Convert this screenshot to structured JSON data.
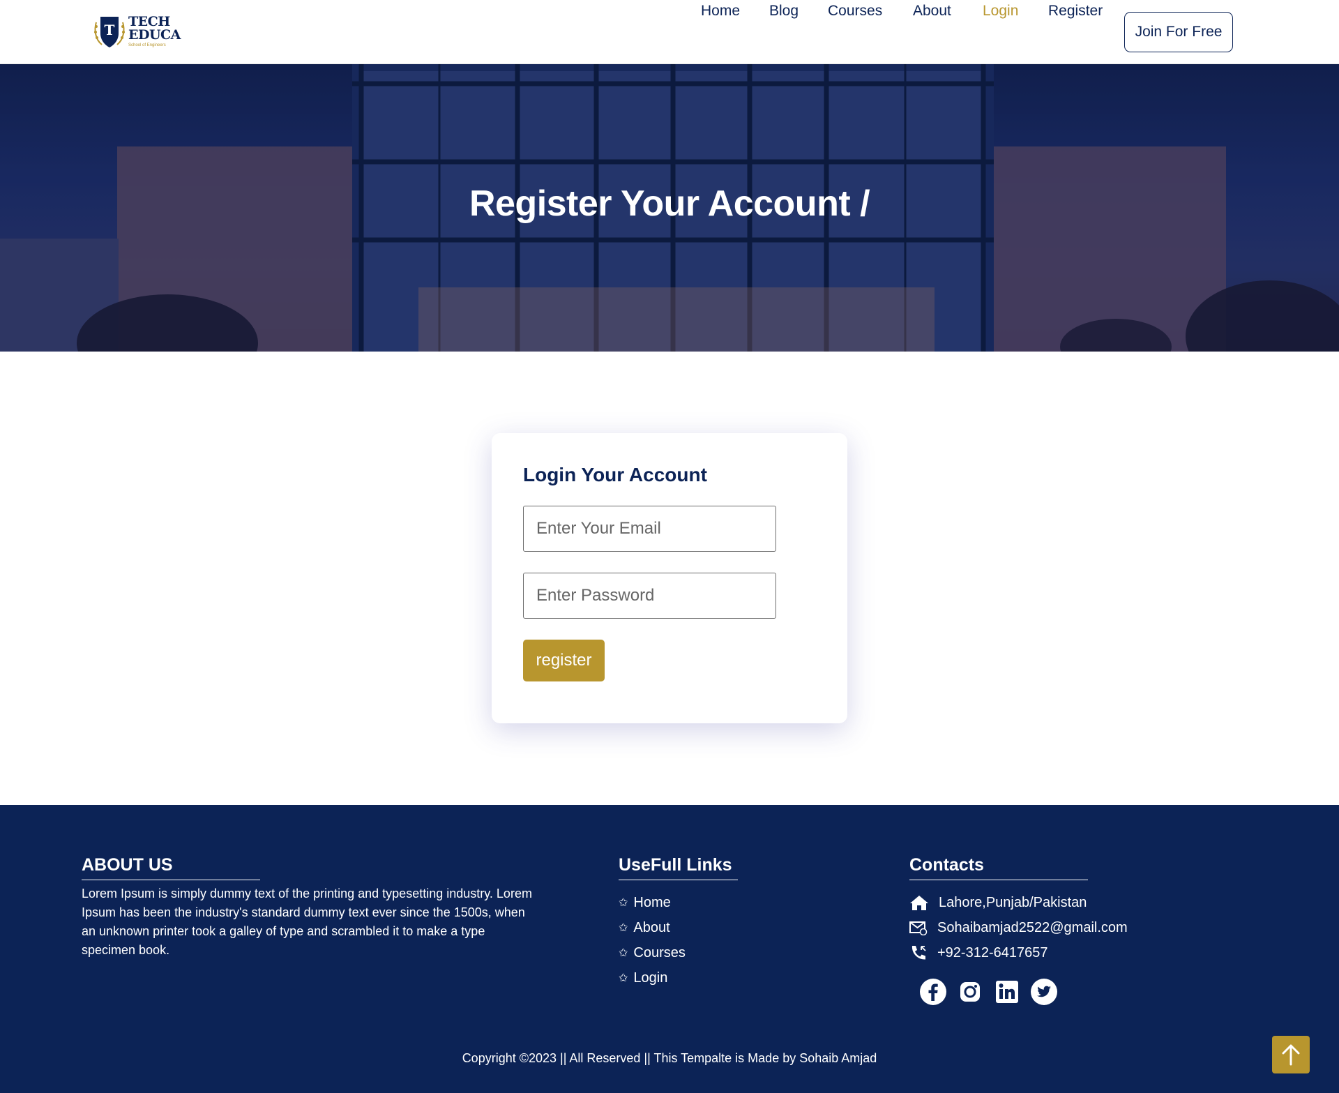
{
  "brand": {
    "name_line1": "TECH",
    "name_line2": "EDUCA",
    "tagline": "School of Engineers",
    "monogram": "T",
    "navy": "#0c2356",
    "gold": "#b8962e"
  },
  "nav": {
    "items": [
      {
        "label": "Home"
      },
      {
        "label": "Blog"
      },
      {
        "label": "Courses"
      },
      {
        "label": "About"
      },
      {
        "label": "Login",
        "active": true
      },
      {
        "label": "Register"
      }
    ],
    "cta_label": "Join For Free"
  },
  "hero": {
    "title": "Register Your Account /"
  },
  "login_card": {
    "title": "Login Your Account",
    "email_placeholder": "Enter Your Email",
    "email_value": "",
    "password_placeholder": "Enter Password",
    "password_value": "",
    "submit_label": "register"
  },
  "footer": {
    "about_heading": "ABOUT US",
    "about_text": "Lorem Ipsum is simply dummy text of the printing and typesetting industry. Lorem Ipsum has been the industry's standard dummy text ever since the 1500s, when an unknown printer took a galley of type and scrambled it to make a type specimen book.",
    "links_heading": "UseFull Links",
    "links": [
      {
        "label": "Home"
      },
      {
        "label": "About"
      },
      {
        "label": "Courses"
      },
      {
        "label": "Login"
      }
    ],
    "link_bullet": "✩",
    "contacts_heading": "Contacts",
    "contacts": {
      "address": "Lahore,Punjab/Pakistan",
      "email": "Sohaibamjad2522@gmail.com",
      "phone": "+92-312-6417657"
    },
    "socials": [
      "facebook-icon",
      "instagram-icon",
      "linkedin-icon",
      "twitter-icon"
    ],
    "copyright": "Copyright ©2023 || All Reserved || This Tempalte is Made by Sohaib Amjad"
  }
}
